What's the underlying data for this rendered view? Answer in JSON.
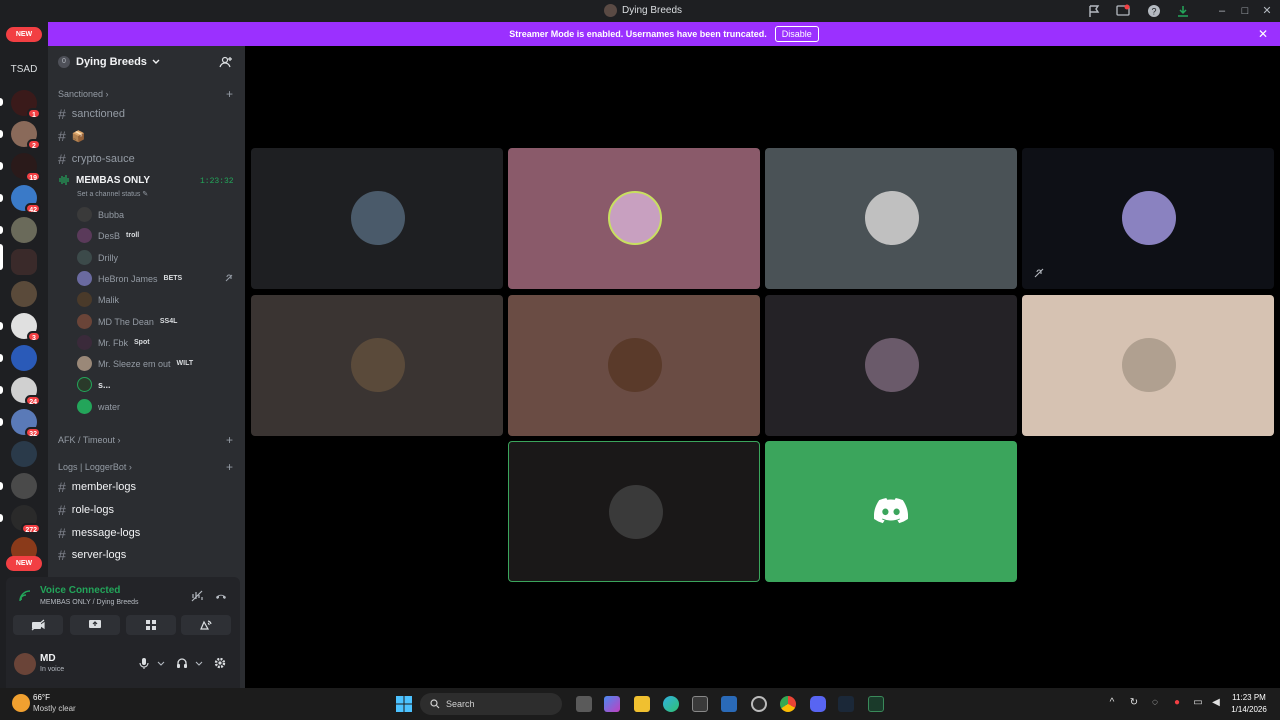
{
  "window": {
    "title": "Dying Breeds"
  },
  "banner": {
    "text": "Streamer Mode is enabled. Usernames have been truncated.",
    "disable_label": "Disable"
  },
  "servers": {
    "new_badge_label": "NEW",
    "tsad_label": "TSAD",
    "badges": [
      "1",
      "2",
      "19",
      "42",
      "3",
      "24",
      "32",
      "272"
    ],
    "new_badge_bottom_label": "NEW"
  },
  "guild": {
    "name": "Dying Breeds",
    "count_badge": "0"
  },
  "categories": {
    "sanctioned": "Sanctioned",
    "afk": "AFK / Timeout",
    "logs": "Logs | LoggerBot"
  },
  "text_channels": [
    {
      "name": "sanctioned"
    },
    {
      "name": "📦"
    },
    {
      "name": "crypto-sauce"
    }
  ],
  "voice_channel": {
    "name": "MEMBAS ONLY",
    "timer": "1:23:32",
    "status_hint": "Set a channel status"
  },
  "voice_users": [
    {
      "name": "Bubba",
      "tag": "",
      "color": "#3a3a3a"
    },
    {
      "name": "DesB",
      "tag": "troll",
      "color": "#5a3a5a"
    },
    {
      "name": "Drilly",
      "tag": "",
      "color": "#3c4a4a"
    },
    {
      "name": "HeBron James",
      "tag": "BETS",
      "color": "#6a6aa0"
    },
    {
      "name": "Malik",
      "tag": "",
      "color": "#4a3a2a"
    },
    {
      "name": "MD The Dean",
      "tag": "SS4L",
      "color": "#6a4438"
    },
    {
      "name": "Mr. Fbk",
      "tag": "Spot",
      "color": "#3a2a3a"
    },
    {
      "name": "Mr. Sleeze em out",
      "tag": "WILT",
      "color": "#9a8878"
    },
    {
      "name": "s...",
      "tag": "",
      "color": "#2a3a2a"
    },
    {
      "name": "water",
      "tag": "",
      "color": "#23a55a"
    }
  ],
  "log_channels": [
    {
      "name": "member-logs"
    },
    {
      "name": "role-logs"
    },
    {
      "name": "message-logs"
    },
    {
      "name": "server-logs"
    }
  ],
  "voice_panel": {
    "status": "Voice Connected",
    "location": "MEMBAS ONLY / Dying Breeds"
  },
  "user": {
    "name": "MD",
    "status": "In voice"
  },
  "tiles": [
    {
      "bg": "#1e1f22",
      "av": "#4a5a6a"
    },
    {
      "bg": "#8a5a6a",
      "av": "#c8a0c0"
    },
    {
      "bg": "#4a5256",
      "av": "#c0c0c0"
    },
    {
      "bg": "#0e1016",
      "av": "#8a82c0"
    },
    {
      "bg": "#3a3432",
      "av": "#5a4a3a"
    },
    {
      "bg": "#6a4c44",
      "av": "#5a3a2a"
    },
    {
      "bg": "#242226",
      "av": "#6a5a6a"
    },
    {
      "bg": "#d6c2b2",
      "av": "#b0a090"
    },
    {
      "bg": "#1a1818",
      "av": "#3a3a3a"
    },
    {
      "bg": "#3ba55c",
      "av": "discord"
    }
  ],
  "taskbar": {
    "weather_temp": "66°F",
    "weather_desc": "Mostly clear",
    "search_placeholder": "Search",
    "time": "11:23 PM",
    "date": "1/14/2026"
  }
}
